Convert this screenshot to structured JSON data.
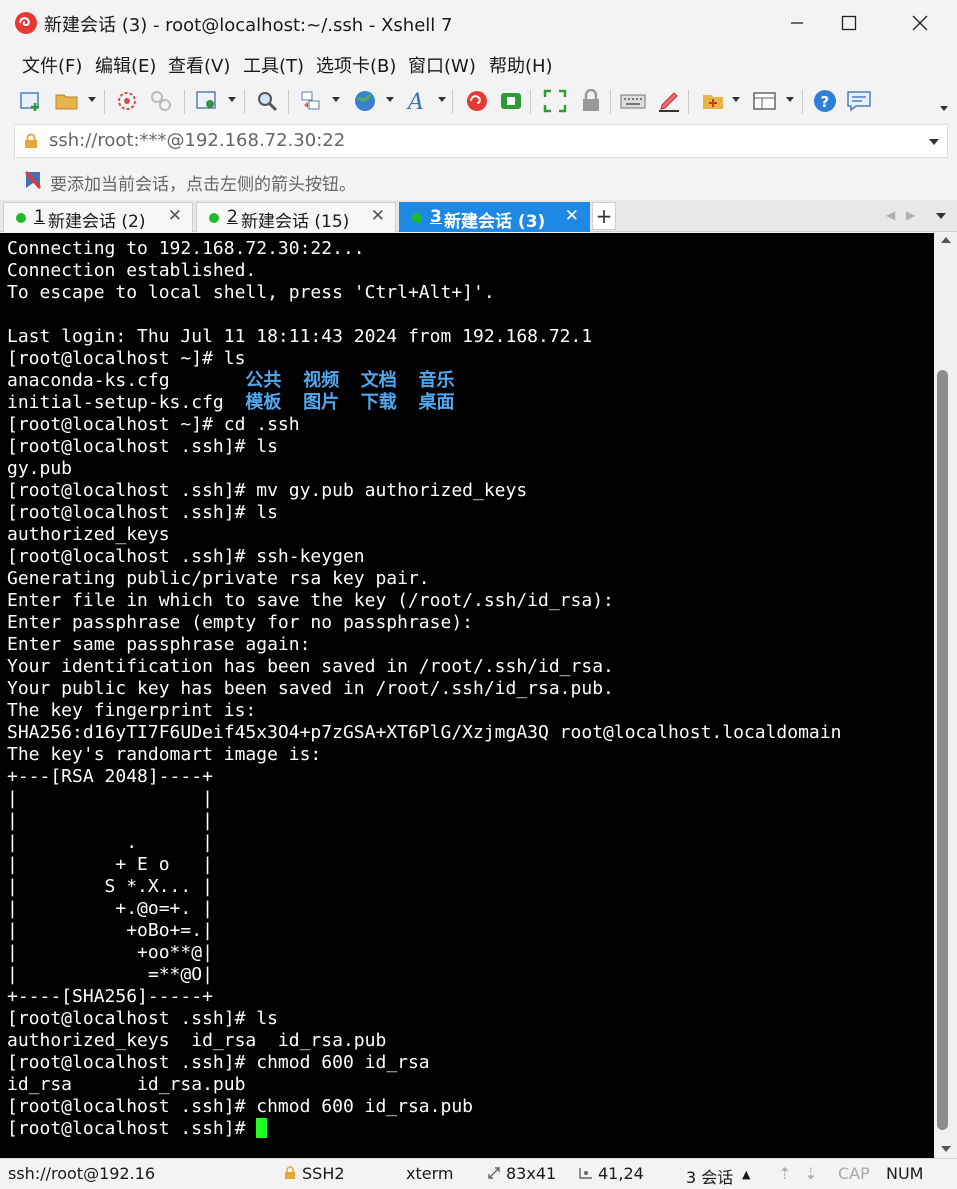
{
  "window": {
    "title": "新建会话 (3) - root@localhost:~/.ssh - Xshell 7",
    "controls": [
      "minimize",
      "maximize",
      "close"
    ]
  },
  "menu": [
    "文件(F)",
    "编辑(E)",
    "查看(V)",
    "工具(T)",
    "选项卡(B)",
    "窗口(W)",
    "帮助(H)"
  ],
  "toolbar": {
    "icons": [
      "new-session-icon",
      "open-folder-icon",
      "disconnect-icon",
      "reconnect-icon",
      "properties-icon",
      "find-icon",
      "transfer-icon",
      "globe-icon",
      "font-icon",
      "xshell-icon",
      "xftp-icon",
      "fullscreen-icon",
      "lock-icon",
      "keyboard-icon",
      "highlight-icon",
      "add-compose-icon",
      "layout-icon",
      "help-icon",
      "chat-icon"
    ]
  },
  "address_bar": {
    "value": "ssh://root:***@192.168.72.30:22"
  },
  "hint_bar": {
    "text": "要添加当前会话，点击左侧的箭头按钮。"
  },
  "tabs": [
    {
      "number": "1",
      "label": " 新建会话 (2)",
      "active": false
    },
    {
      "number": "2",
      "label": " 新建会话 (15)",
      "active": false
    },
    {
      "number": "3",
      "label": " 新建会话 (3)",
      "active": true
    }
  ],
  "terminal": {
    "prompt": "[root@localhost .ssh]# ",
    "lines": [
      [
        {
          "t": "Connecting to 192.168.72.30:22..."
        }
      ],
      [
        {
          "t": "Connection established."
        }
      ],
      [
        {
          "t": "To escape to local shell, press 'Ctrl+Alt+]'."
        }
      ],
      [
        {
          "t": ""
        }
      ],
      [
        {
          "t": "Last login: Thu Jul 11 18:11:43 2024 from 192.168.72.1"
        }
      ],
      [
        {
          "t": "[root@localhost ~]# ls"
        }
      ],
      [
        {
          "t": "anaconda-ks.cfg       "
        },
        {
          "t": "公共",
          "c": "blue"
        },
        {
          "t": "  "
        },
        {
          "t": "视频",
          "c": "blue"
        },
        {
          "t": "  "
        },
        {
          "t": "文档",
          "c": "blue"
        },
        {
          "t": "  "
        },
        {
          "t": "音乐",
          "c": "blue"
        }
      ],
      [
        {
          "t": "initial-setup-ks.cfg  "
        },
        {
          "t": "模板",
          "c": "blue"
        },
        {
          "t": "  "
        },
        {
          "t": "图片",
          "c": "blue"
        },
        {
          "t": "  "
        },
        {
          "t": "下载",
          "c": "blue"
        },
        {
          "t": "  "
        },
        {
          "t": "桌面",
          "c": "blue"
        }
      ],
      [
        {
          "t": "[root@localhost ~]# cd .ssh"
        }
      ],
      [
        {
          "t": "[root@localhost .ssh]# ls"
        }
      ],
      [
        {
          "t": "gy.pub"
        }
      ],
      [
        {
          "t": "[root@localhost .ssh]# mv gy.pub authorized_keys"
        }
      ],
      [
        {
          "t": "[root@localhost .ssh]# ls"
        }
      ],
      [
        {
          "t": "authorized_keys"
        }
      ],
      [
        {
          "t": "[root@localhost .ssh]# ssh-keygen"
        }
      ],
      [
        {
          "t": "Generating public/private rsa key pair."
        }
      ],
      [
        {
          "t": "Enter file in which to save the key (/root/.ssh/id_rsa):"
        }
      ],
      [
        {
          "t": "Enter passphrase (empty for no passphrase):"
        }
      ],
      [
        {
          "t": "Enter same passphrase again:"
        }
      ],
      [
        {
          "t": "Your identification has been saved in /root/.ssh/id_rsa."
        }
      ],
      [
        {
          "t": "Your public key has been saved in /root/.ssh/id_rsa.pub."
        }
      ],
      [
        {
          "t": "The key fingerprint is:"
        }
      ],
      [
        {
          "t": "SHA256:d16yTI7F6UDeif45x3O4+p7zGSA+XT6PlG/XzjmgA3Q root@localhost.localdomain"
        }
      ],
      [
        {
          "t": "The key's randomart image is:"
        }
      ],
      [
        {
          "t": "+---[RSA 2048]----+"
        }
      ],
      [
        {
          "t": "|                 |"
        }
      ],
      [
        {
          "t": "|                 |"
        }
      ],
      [
        {
          "t": "|          .      |"
        }
      ],
      [
        {
          "t": "|         + E o   |"
        }
      ],
      [
        {
          "t": "|        S *.X... |"
        }
      ],
      [
        {
          "t": "|         +.@o=+. |"
        }
      ],
      [
        {
          "t": "|          +oBo+=.|"
        }
      ],
      [
        {
          "t": "|           +oo**@|"
        }
      ],
      [
        {
          "t": "|            =**@O|"
        }
      ],
      [
        {
          "t": "+----[SHA256]-----+"
        }
      ],
      [
        {
          "t": "[root@localhost .ssh]# ls"
        }
      ],
      [
        {
          "t": "authorized_keys  id_rsa  id_rsa.pub"
        }
      ],
      [
        {
          "t": "[root@localhost .ssh]# chmod 600 id_rsa"
        }
      ],
      [
        {
          "t": "id_rsa      id_rsa.pub"
        }
      ],
      [
        {
          "t": "[root@localhost .ssh]# chmod 600 id_rsa.pub"
        }
      ]
    ],
    "colors": {
      "background": "#000000",
      "foreground": "#ffffff",
      "directory": "#4fa8f0",
      "cursor": "#22ff22"
    }
  },
  "status_bar": {
    "connection": "ssh://root@192.16",
    "protocol": "SSH2",
    "terminal_type": "xterm",
    "size": "83x41",
    "cursor_pos": "41,24",
    "sessions": "3 会话",
    "cap": "CAP",
    "num": "NUM"
  },
  "accent_color": "#1e88e5"
}
